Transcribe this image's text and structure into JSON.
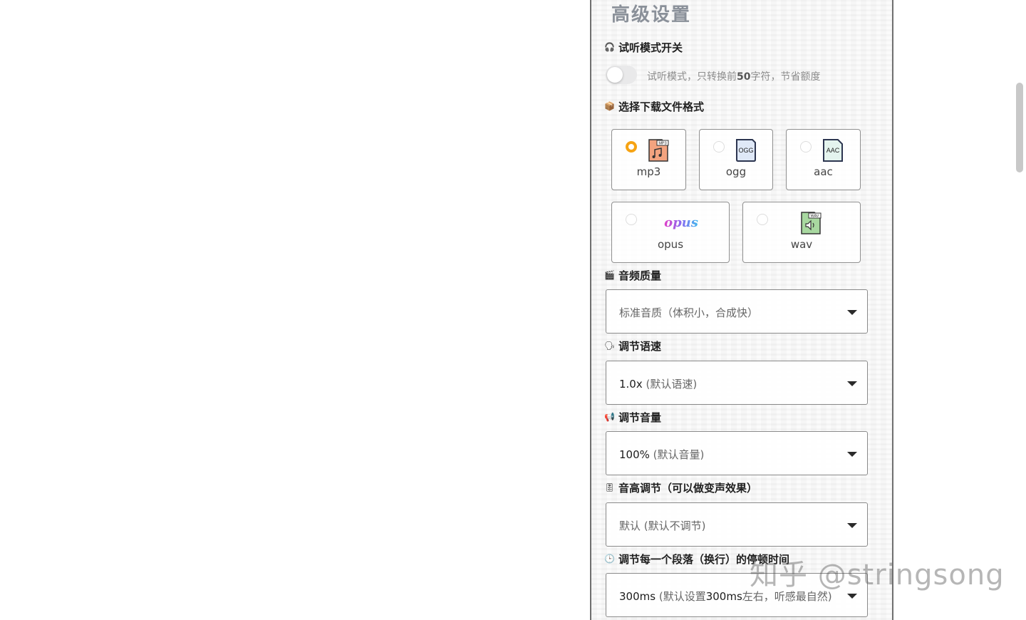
{
  "panel": {
    "title": "高级设置"
  },
  "preview": {
    "label": "试听模式开关",
    "enabled": false,
    "desc_prefix": "试听模式，只转换前",
    "desc_number": "50",
    "desc_suffix": "字符，节省额度"
  },
  "format": {
    "label": "选择下载文件格式",
    "options": [
      {
        "label": "mp3",
        "checked": true,
        "icon": "mp3-file-icon",
        "badge": "MP3"
      },
      {
        "label": "ogg",
        "checked": false,
        "icon": "ogg-file-icon",
        "badge": "OGG"
      },
      {
        "label": "aac",
        "checked": false,
        "icon": "aac-file-icon",
        "badge": "AAC"
      },
      {
        "label": "opus",
        "checked": false,
        "icon": "opus-logo-icon",
        "badge": "opus"
      },
      {
        "label": "wav",
        "checked": false,
        "icon": "wav-file-icon",
        "badge": "WAV"
      }
    ],
    "selected_color": "#f6a313"
  },
  "quality": {
    "label": "音频质量",
    "value": "标准音质（体积小，合成快）"
  },
  "speed": {
    "label": "调节语速",
    "value_main": "1.0x",
    "value_note": "(默认语速)"
  },
  "volume": {
    "label": "调节音量",
    "value_main": "100%",
    "value_note": "(默认音量)"
  },
  "pitch": {
    "label": "音高调节（可以做变声效果）",
    "value_main": "默认",
    "value_note": "(默认不调节)"
  },
  "pause": {
    "label": "调节每一个段落（换行）的停顿时间",
    "value_main": "300ms",
    "value_note_a": "(默认设置",
    "value_note_b": "300ms",
    "value_note_c": "左右，听感最自然)"
  },
  "watermark": "知乎 @stringsong"
}
